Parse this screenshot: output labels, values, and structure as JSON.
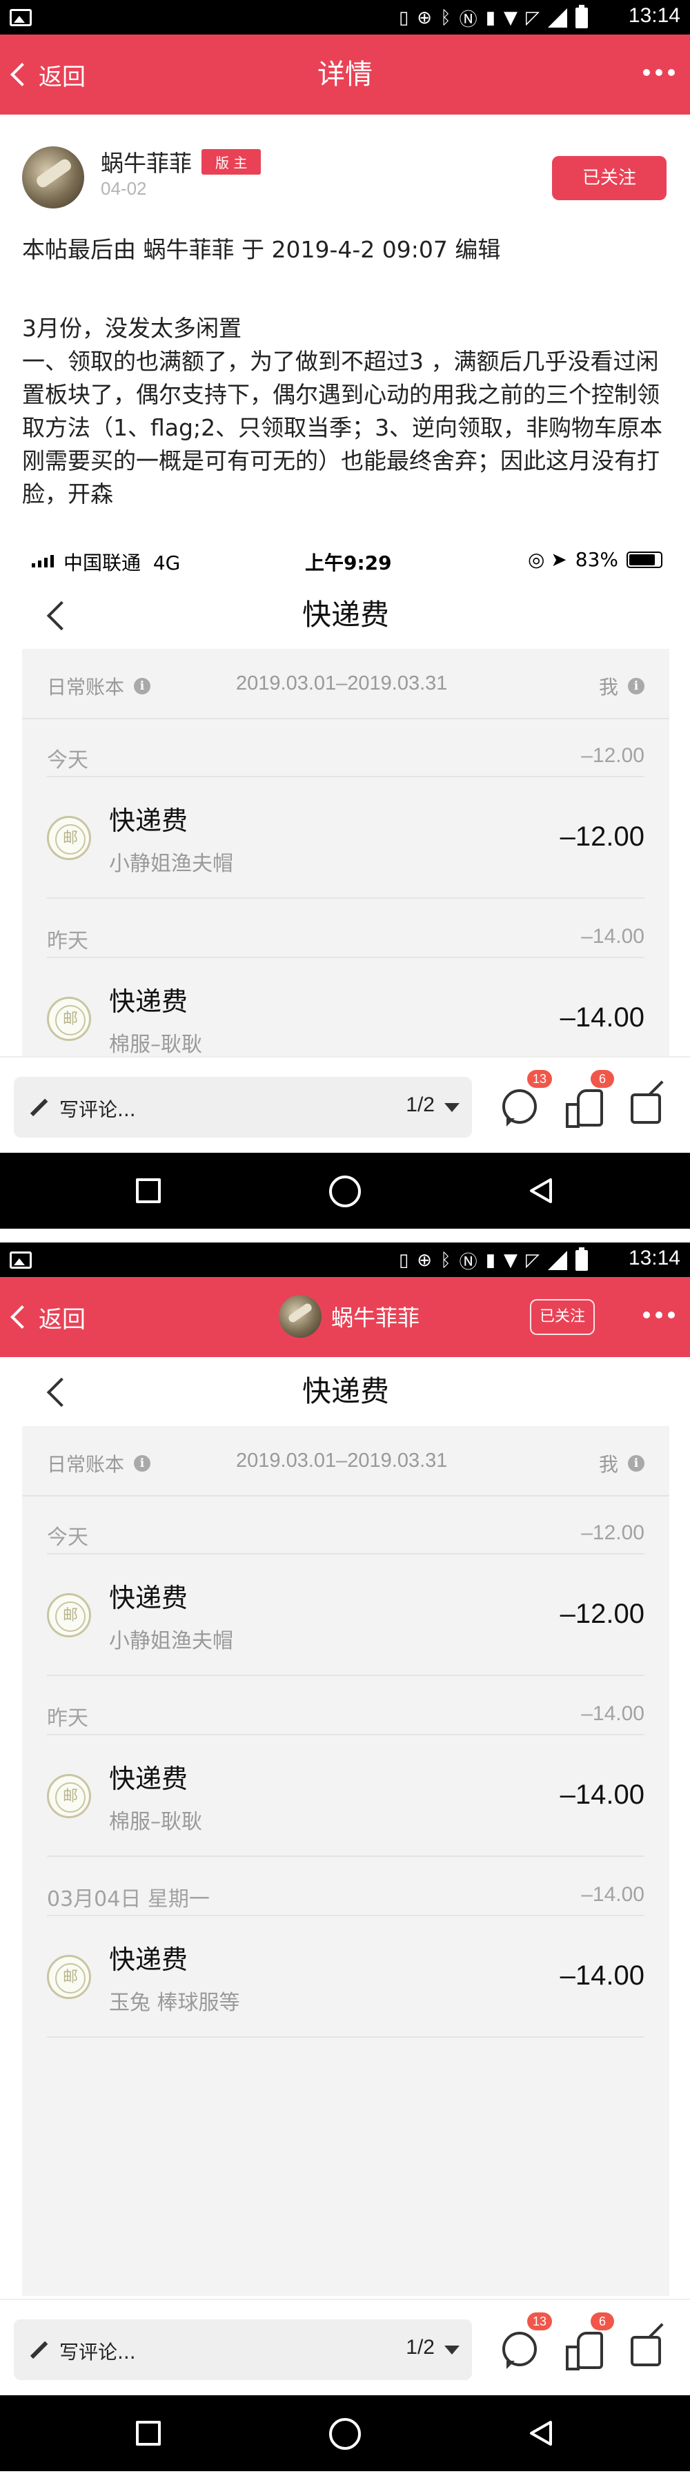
{
  "status_bar": {
    "time": "13:14"
  },
  "header": {
    "back_label": "返回",
    "title": "详情"
  },
  "post": {
    "author": "蜗牛菲菲",
    "role_badge": "版 主",
    "date": "04-02",
    "follow_label": "已关注",
    "edit_note": "本帖最后由 蜗牛菲菲 于 2019-4-2 09:07 编辑",
    "paragraph1": "3月份，没发太多闲置",
    "paragraph2": "一、领取的也满额了，为了做到不超过3 ，满额后几乎没看过闲置板块了，偶尔支持下，偶尔遇到心动的用我之前的三个控制领取方法（1、flag;2、只领取当季；3、逆向领取，非购物车原本刚需要买的一概是可有可无的）也能最终舍弃；因此这月没有打脸，开森"
  },
  "ios_status": {
    "carrier": "中国联通",
    "network": "4G",
    "time": "上午9:29",
    "battery": "83%",
    "battery_level": 0.83
  },
  "bill": {
    "title": "快递费",
    "summary_label": "日常账本",
    "date_range": "2019.03.01–2019.03.31",
    "owner": "我",
    "groups": [
      {
        "day": "今天",
        "total": "–12.00",
        "entries": [
          {
            "name": "快递费",
            "note": "小静姐渔夫帽",
            "amount": "–12.00"
          }
        ]
      },
      {
        "day": "昨天",
        "total": "–14.00",
        "entries": [
          {
            "name": "快递费",
            "note": "棉服–耿耿",
            "amount": "–14.00"
          }
        ]
      },
      {
        "day": "03月04日 星期一",
        "total": "–14.00",
        "entries": [
          {
            "name": "快递费",
            "note": "玉兔 棒球服等",
            "amount": "–14.00"
          }
        ]
      }
    ]
  },
  "comment_bar": {
    "placeholder": "写评论...",
    "page": "1/2",
    "comment_count": "13",
    "like_count": "6"
  },
  "second_header": {
    "back_label": "返回",
    "author": "蜗牛菲菲",
    "follow_label": "已关注"
  },
  "colors": {
    "brand_red": "#e94256",
    "badge_red": "#f0574a",
    "bill_bg": "#f3f3f4"
  },
  "icons": [
    "picture-icon",
    "vibrate-icon",
    "nfc-icon",
    "bluetooth-icon",
    "wifi-icon",
    "signal-icon",
    "battery-icon",
    "more-icon",
    "comment-icon",
    "like-icon",
    "share-icon",
    "pen-icon",
    "post-icon"
  ]
}
